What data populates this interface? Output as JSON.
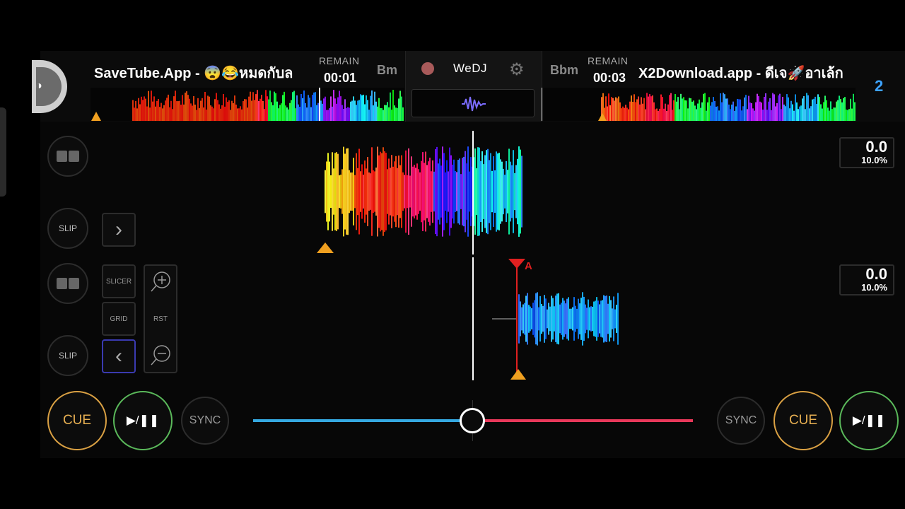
{
  "deck_a": {
    "title": "SaveTube.App - 😨😂หมดกับล",
    "remain_label": "REMAIN",
    "remain_time": "00:01",
    "key": "Bm",
    "slip_label": "SLIP",
    "cue_label": "CUE",
    "play_label": "▶/❚❚",
    "sync_label": "SYNC",
    "pitch_value": "0.0",
    "pitch_range": "10.0%"
  },
  "deck_b": {
    "title": "X2Download.app - ดีเจ🚀อาเล้ก",
    "remain_label": "REMAIN",
    "remain_time": "00:03",
    "key": "Bbm",
    "slip_label": "SLIP",
    "cue_label": "CUE",
    "play_label": "▶/❚❚",
    "sync_label": "SYNC",
    "pitch_value": "0.0",
    "pitch_range": "10.0%",
    "deck_number": "2",
    "cue_marker": "A"
  },
  "center": {
    "brand": "WeDJ",
    "gear_icon": "⚙"
  },
  "tools": {
    "slicer_label": "SLICER",
    "grid_label": "GRID",
    "reset_label": "RST"
  },
  "crossfader": {
    "position": 0.5,
    "left_color": "#35a8e0",
    "right_color": "#e8385a"
  },
  "colors": {
    "cue": "#d9a043",
    "play": "#5ab85a",
    "accent_blue": "#3ea3ff",
    "marker_orange": "#f0a020",
    "marker_red": "#e02020"
  }
}
